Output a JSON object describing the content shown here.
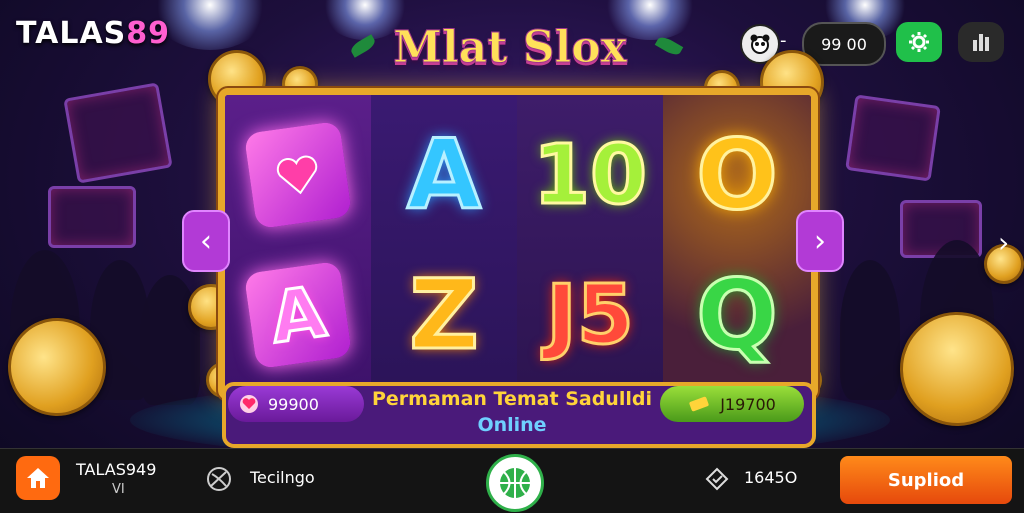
{
  "brand": {
    "name_part1": "TALAS",
    "name_part2": "89"
  },
  "header": {
    "game_title": "Mlat Slox",
    "balance": "99 00",
    "balance_separator": "-",
    "avatar_icon": "panda-avatar-icon",
    "settings_icon": "gear-icon",
    "stats_icon": "bar-chart-icon"
  },
  "reels": {
    "row1": [
      {
        "symbol": "heart-gem-icon",
        "label": ""
      },
      {
        "symbol": "letter",
        "label": "A",
        "color": "#34c6ff"
      },
      {
        "symbol": "number",
        "label": "10",
        "color": "#a5f03a"
      },
      {
        "symbol": "letter",
        "label": "O",
        "color": "#ffc21a"
      }
    ],
    "row2": [
      {
        "symbol": "gem-letter",
        "label": "A",
        "color": "#ff6ae8"
      },
      {
        "symbol": "letter",
        "label": "Z",
        "color": "#ffb81a"
      },
      {
        "symbol": "number",
        "label": "J5",
        "color": "#ff4a3a"
      },
      {
        "symbol": "letter",
        "label": "Q",
        "color": "#39d646"
      }
    ]
  },
  "nav": {
    "prev_icon": "chevron-left-icon",
    "next_icon": "chevron-right-icon",
    "prev_glyph": "‹",
    "next_glyph": "›"
  },
  "info_bar": {
    "left_amount": "99900",
    "promo_line1": "Permaman Temat Sadulldi",
    "promo_line2": "Online",
    "right_amount": "J19700"
  },
  "bottom_bar": {
    "home_icon": "home-icon",
    "user_name": "TALAS949",
    "user_sub": "VI",
    "nav_label": "Tecilngo",
    "center_icon": "basketball-icon",
    "coins_value": "1645O",
    "cta_label": "Supliod"
  },
  "colors": {
    "accent_gold": "#e7a82a",
    "brand_pink": "#ff5fd0",
    "cta_orange": "#ff8a1a",
    "settings_green": "#20c04a"
  }
}
